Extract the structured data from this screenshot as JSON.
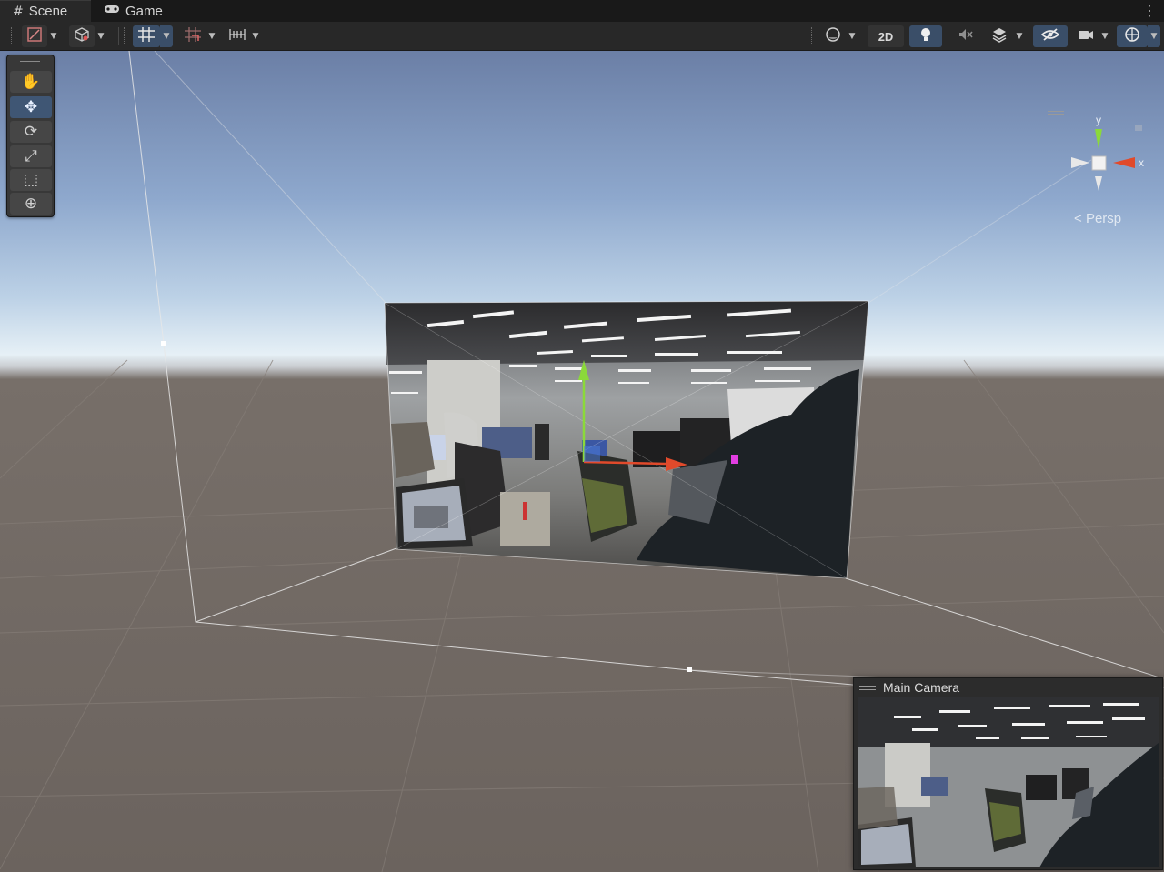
{
  "tabs": [
    {
      "label": "Scene",
      "icon": "hash-icon",
      "active": true
    },
    {
      "label": "Game",
      "icon": "gamepad-icon",
      "active": false
    }
  ],
  "toolbar": {
    "toggle_2d_label": "2D"
  },
  "tools_overlay": {
    "tools": [
      "hand",
      "move",
      "rotate",
      "scale",
      "rect",
      "transform"
    ],
    "active_tool": "move"
  },
  "gizmo": {
    "axis_y": "y",
    "axis_x": "x",
    "projection_label": "Persp"
  },
  "camera_preview": {
    "title": "Main Camera"
  },
  "colors": {
    "accent": "#3a4e68",
    "axis_x": "#e14a2b",
    "axis_y": "#8bd93a",
    "axis_z": "#4a7ad9"
  }
}
